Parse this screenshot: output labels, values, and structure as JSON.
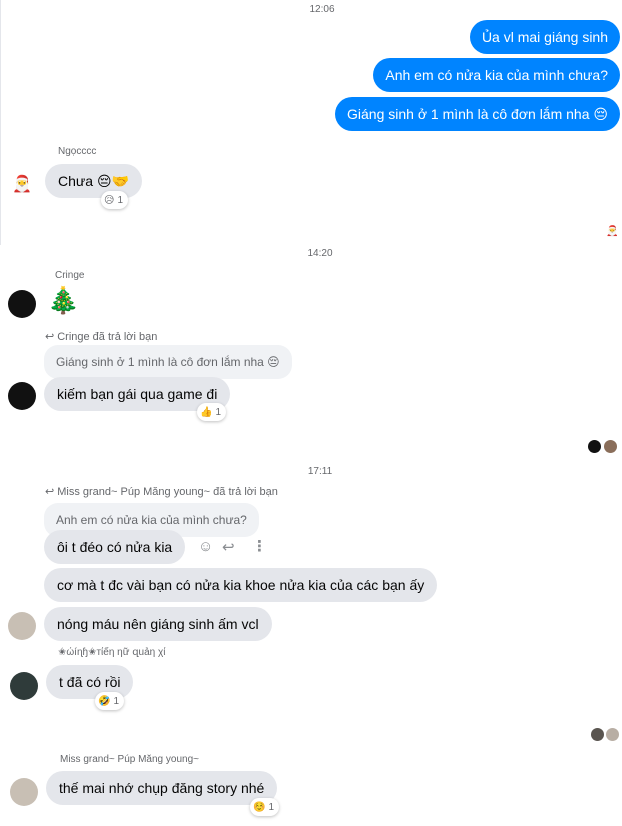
{
  "timestamps": [
    "12:06",
    "14:20",
    "17:11"
  ],
  "outgoing": [
    "Ủa vl mai giáng sinh",
    "Anh em có nửa kia của mình chưa?",
    "Giáng sinh ở 1 mình là cô đơn lắm nha 😔"
  ],
  "group1": {
    "sender": "Ngọcccc",
    "message": "Chưa 😔🤝",
    "reaction": {
      "emoji": "😥",
      "count": "1"
    },
    "avatar_icon": "santa-icon"
  },
  "group2": {
    "sender": "Cringe",
    "sticker": "🎄",
    "reply_label": "Cringe đã trả lời bạn",
    "quoted": "Giáng sinh ở 1 mình là cô đơn lắm nha 😔",
    "message": "kiếm bạn gái qua game đi",
    "reaction": {
      "emoji": "👍",
      "count": "1"
    }
  },
  "group3": {
    "reply_label_name": "Miss grand~ Púp Măng young~",
    "reply_label_suffix": "đã trả lời bạn",
    "quoted": "Anh em có nửa kia của mình chưa?",
    "messages": [
      "ôi t đéo có nửa kia",
      "cơ mà t đc vài bạn có nửa kia khoe nửa kia của các bạn ấy",
      "nóng máu nên giáng sinh ấm vcl"
    ]
  },
  "group4": {
    "sender": "✬ώíɳɧ✬тίếη ηữ զuảη χί",
    "message": "t đã có rồi",
    "reaction": {
      "emoji": "🤣",
      "count": "1"
    }
  },
  "group5": {
    "sender": "Miss grand~ Púp Măng young~",
    "message": "thế mai nhớ chụp đăng story nhé",
    "reaction": {
      "emoji": "☺️",
      "count": "1"
    }
  },
  "colors": {
    "outgoing": "#0084ff",
    "incoming": "#e4e6eb",
    "quote": "#f0f2f5"
  }
}
